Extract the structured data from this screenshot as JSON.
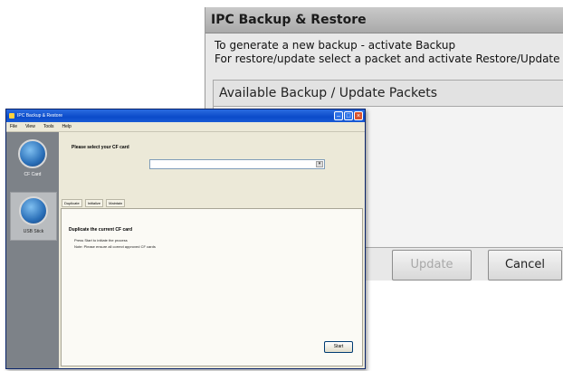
{
  "ipc": {
    "title": "IPC Backup & Restore",
    "line1": "To generate a new backup - activate Backup",
    "line2": "For restore/update select a packet and activate Restore/Update",
    "panel_header": "Available Backup / Update Packets",
    "buttons": [
      {
        "label": "Update",
        "enabled": false
      },
      {
        "label": "Cancel",
        "enabled": true
      }
    ]
  },
  "xp": {
    "title": "IPC Backup & Restore",
    "menu": [
      "File",
      "View",
      "Tools",
      "Help"
    ],
    "side": [
      {
        "label": "CF Card",
        "selected": false
      },
      {
        "label": "USB Stick",
        "selected": true
      }
    ],
    "prompt": "Please select your CF card",
    "tabs": [
      "Duplicate",
      "Initialize",
      "Maintain"
    ],
    "group_title": "Duplicate the current CF card",
    "group_lines": [
      "Press Start to initiate the process",
      "Note: Please ensure all correct approved CF cards"
    ],
    "start_label": "Start"
  }
}
